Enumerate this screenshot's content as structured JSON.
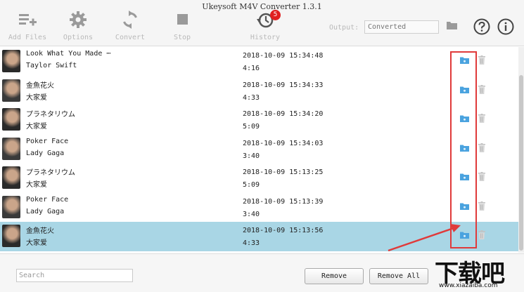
{
  "app": {
    "title": "Ukeysoft M4V Converter 1.3.1"
  },
  "toolbar": {
    "add_files": "Add Files",
    "options": "Options",
    "convert": "Convert",
    "stop": "Stop",
    "history": "History",
    "history_badge": "5",
    "output_label": "Output:",
    "output_placeholder": "Converted"
  },
  "items": [
    {
      "title": "Look What You Made ⋯",
      "artist": "Taylor Swift",
      "date": "2018-10-09 15:34:48",
      "duration": "4:16",
      "selected": false
    },
    {
      "title": "金魚花火",
      "artist": "大家爱",
      "date": "2018-10-09 15:34:33",
      "duration": "4:33",
      "selected": false
    },
    {
      "title": "プラネタリウム",
      "artist": "大家爱",
      "date": "2018-10-09 15:34:20",
      "duration": "5:09",
      "selected": false
    },
    {
      "title": "Poker Face",
      "artist": "Lady Gaga",
      "date": "2018-10-09 15:34:03",
      "duration": "3:40",
      "selected": false
    },
    {
      "title": "プラネタリウム",
      "artist": "大家爱",
      "date": "2018-10-09 15:13:25",
      "duration": "5:09",
      "selected": false
    },
    {
      "title": "Poker Face",
      "artist": "Lady Gaga",
      "date": "2018-10-09 15:13:39",
      "duration": "3:40",
      "selected": false
    },
    {
      "title": "金魚花火",
      "artist": "大家爱",
      "date": "2018-10-09 15:13:56",
      "duration": "4:33",
      "selected": true
    }
  ],
  "footer": {
    "search_placeholder": "Search",
    "remove_label": "Remove",
    "remove_all_label": "Remove All"
  },
  "watermark": {
    "main": "下载吧",
    "url": "www.xiazaiba.com"
  },
  "colors": {
    "selected_row": "#a9d6e5",
    "highlight": "#e03a3a",
    "folder_blue": "#4aa3df",
    "badge_red": "#e02020"
  }
}
